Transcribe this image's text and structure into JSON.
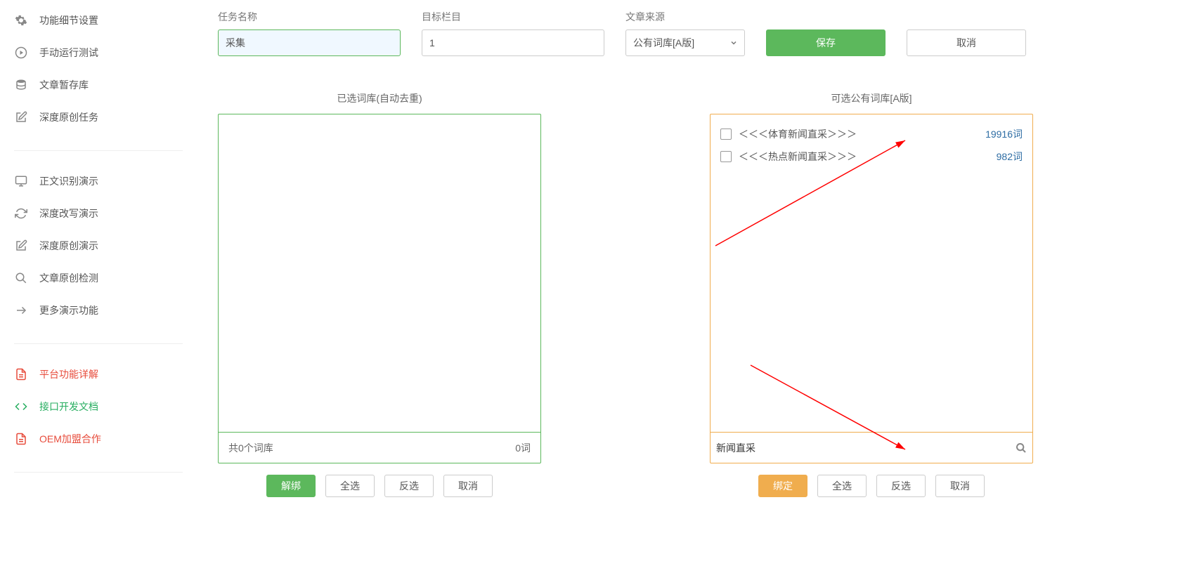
{
  "sidebar": {
    "group1": [
      {
        "label": "功能细节设置",
        "icon": "cogs-icon"
      },
      {
        "label": "手动运行测试",
        "icon": "play-icon"
      },
      {
        "label": "文章暂存库",
        "icon": "database-icon"
      },
      {
        "label": "深度原创任务",
        "icon": "edit-icon"
      }
    ],
    "group2": [
      {
        "label": "正文识别演示",
        "icon": "monitor-icon"
      },
      {
        "label": "深度改写演示",
        "icon": "refresh-icon"
      },
      {
        "label": "深度原创演示",
        "icon": "edit-icon"
      },
      {
        "label": "文章原创检测",
        "icon": "search-icon"
      },
      {
        "label": "更多演示功能",
        "icon": "share-icon"
      }
    ],
    "group3": [
      {
        "label": "平台功能详解",
        "icon": "file-icon",
        "cls": "red"
      },
      {
        "label": "接口开发文档",
        "icon": "code-icon",
        "cls": "green"
      },
      {
        "label": "OEM加盟合作",
        "icon": "file-icon",
        "cls": "red"
      }
    ]
  },
  "form": {
    "task_label": "任务名称",
    "task_value": "采集",
    "column_label": "目标栏目",
    "column_value": "1",
    "source_label": "文章来源",
    "source_value": "公有词库[A版]",
    "save_label": "保存",
    "cancel_label": "取消"
  },
  "left_panel": {
    "title": "已选词库(自动去重)",
    "footer_left": "共0个词库",
    "footer_right": "0词",
    "buttons": {
      "unbind": "解绑",
      "selall": "全选",
      "invert": "反选",
      "cancel": "取消"
    }
  },
  "right_panel": {
    "title": "可选公有词库[A版]",
    "items": [
      {
        "name": "＜＜＜体育新闻直采＞＞＞",
        "count": "19916词"
      },
      {
        "name": "＜＜＜热点新闻直采＞＞＞",
        "count": "982词"
      }
    ],
    "search_value": "新闻直采",
    "buttons": {
      "bind": "绑定",
      "selall": "全选",
      "invert": "反选",
      "cancel": "取消"
    }
  }
}
